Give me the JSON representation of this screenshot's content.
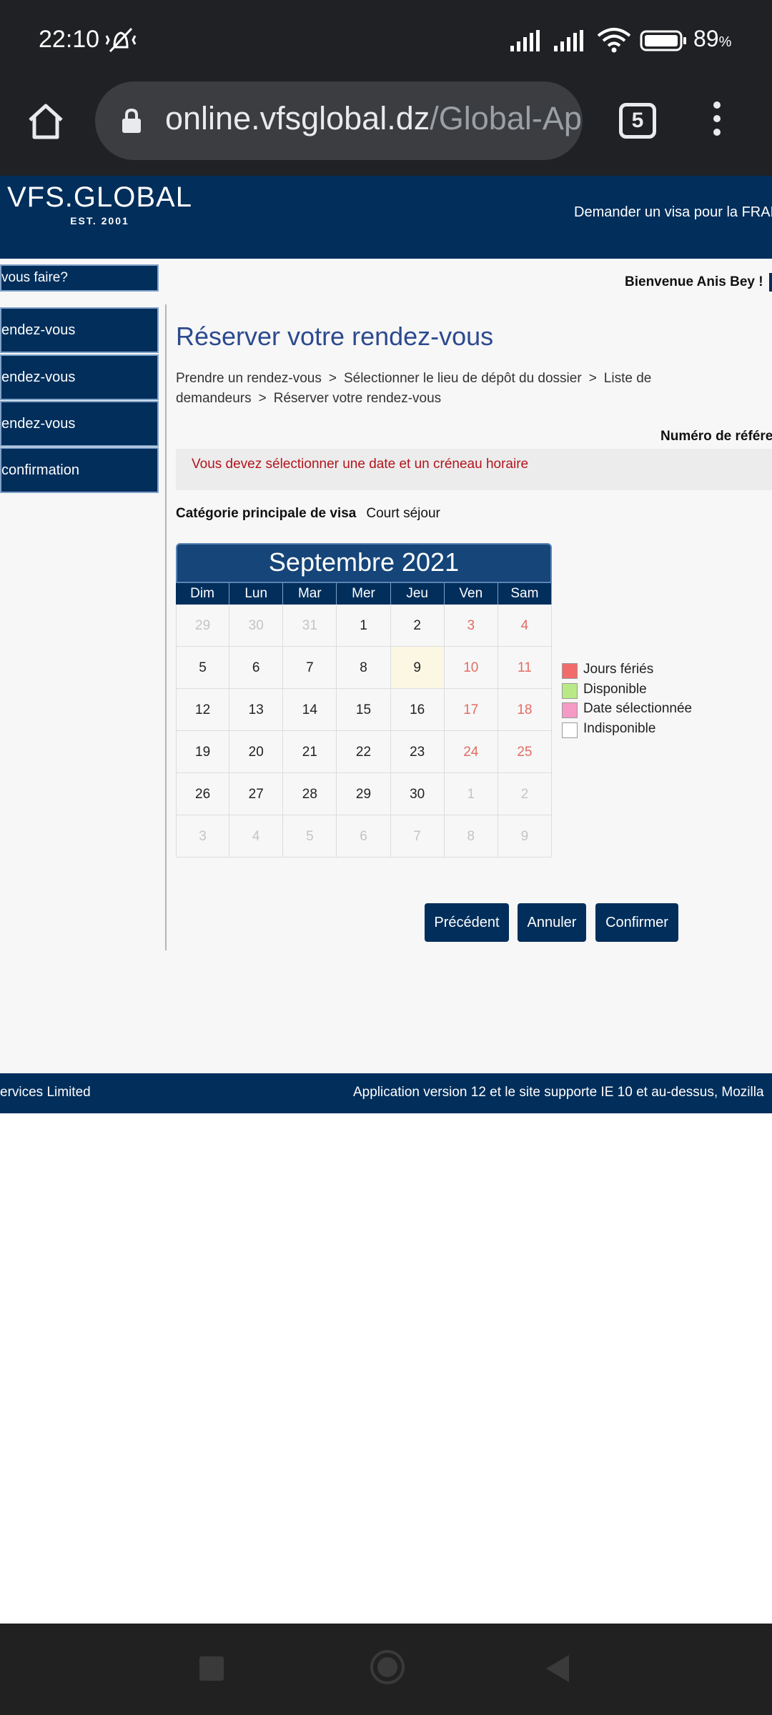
{
  "status_bar": {
    "time": "22:10",
    "battery_percent": "89",
    "battery_unit": "%"
  },
  "browser": {
    "url_domain": "online.vfsglobal.dz",
    "url_path": "/Global-Ap",
    "tab_count": "5"
  },
  "header": {
    "logo_main": "VFS.GLOBAL",
    "logo_sub": "EST. 2001",
    "visa_link": "Demander un visa pour la FRAN"
  },
  "sidebar": {
    "title": "vous faire?",
    "items": [
      {
        "label": "endez-vous"
      },
      {
        "label": "endez-vous"
      },
      {
        "label": "endez-vous"
      },
      {
        "label": "confirmation"
      }
    ]
  },
  "welcome": "Bienvenue Anis Bey !",
  "content": {
    "title": "Réserver votre rendez-vous",
    "breadcrumb": [
      "Prendre un rendez-vous",
      "Sélectionner le lieu de dépôt du dossier",
      "Liste de demandeurs",
      "Réserver votre rendez-vous"
    ],
    "breadcrumb_sep": ">",
    "reference_label": "Numéro de référen",
    "error_message": "Vous devez sélectionner une date et un créneau horaire",
    "visa_category_label": "Catégorie principale de visa",
    "visa_category_value": "Court séjour"
  },
  "calendar": {
    "month_label": "Septembre 2021",
    "weekdays": [
      "Dim",
      "Lun",
      "Mar",
      "Mer",
      "Jeu",
      "Ven",
      "Sam"
    ],
    "weeks": [
      [
        {
          "d": "29",
          "s": "other"
        },
        {
          "d": "30",
          "s": "other"
        },
        {
          "d": "31",
          "s": "other"
        },
        {
          "d": "1",
          "s": ""
        },
        {
          "d": "2",
          "s": ""
        },
        {
          "d": "3",
          "s": "holiday"
        },
        {
          "d": "4",
          "s": "holiday"
        }
      ],
      [
        {
          "d": "5",
          "s": ""
        },
        {
          "d": "6",
          "s": ""
        },
        {
          "d": "7",
          "s": ""
        },
        {
          "d": "8",
          "s": ""
        },
        {
          "d": "9",
          "s": "today"
        },
        {
          "d": "10",
          "s": "holiday"
        },
        {
          "d": "11",
          "s": "holiday"
        }
      ],
      [
        {
          "d": "12",
          "s": ""
        },
        {
          "d": "13",
          "s": ""
        },
        {
          "d": "14",
          "s": ""
        },
        {
          "d": "15",
          "s": ""
        },
        {
          "d": "16",
          "s": ""
        },
        {
          "d": "17",
          "s": "holiday"
        },
        {
          "d": "18",
          "s": "holiday"
        }
      ],
      [
        {
          "d": "19",
          "s": ""
        },
        {
          "d": "20",
          "s": ""
        },
        {
          "d": "21",
          "s": ""
        },
        {
          "d": "22",
          "s": ""
        },
        {
          "d": "23",
          "s": ""
        },
        {
          "d": "24",
          "s": "holiday"
        },
        {
          "d": "25",
          "s": "holiday"
        }
      ],
      [
        {
          "d": "26",
          "s": ""
        },
        {
          "d": "27",
          "s": ""
        },
        {
          "d": "28",
          "s": ""
        },
        {
          "d": "29",
          "s": ""
        },
        {
          "d": "30",
          "s": ""
        },
        {
          "d": "1",
          "s": "other"
        },
        {
          "d": "2",
          "s": "other"
        }
      ],
      [
        {
          "d": "3",
          "s": "other"
        },
        {
          "d": "4",
          "s": "other"
        },
        {
          "d": "5",
          "s": "other"
        },
        {
          "d": "6",
          "s": "other"
        },
        {
          "d": "7",
          "s": "other"
        },
        {
          "d": "8",
          "s": "other"
        },
        {
          "d": "9",
          "s": "other"
        }
      ]
    ]
  },
  "legend": [
    {
      "label": "Jours fériés",
      "color": "#f26b6b"
    },
    {
      "label": "Disponible",
      "color": "#b8e986"
    },
    {
      "label": "Date sélectionnée",
      "color": "#f59ac5"
    },
    {
      "label": "Indisponible",
      "color": "#ffffff"
    }
  ],
  "buttons": {
    "previous": "Précédent",
    "cancel": "Annuler",
    "confirm": "Confirmer"
  },
  "footer": {
    "left": "ervices Limited",
    "right": "Application version 12 et le site supporte IE 10 et au-dessus, Mozilla"
  },
  "colors": {
    "brand_navy": "#012e5b",
    "error_red": "#b3141d",
    "holiday_text": "#e46c62",
    "title_blue": "#2c4a8f"
  }
}
